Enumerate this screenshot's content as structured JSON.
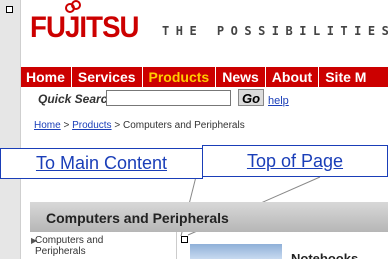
{
  "logo": {
    "text": "FUJITSU"
  },
  "tagline": "THE POSSIBILITIES ARE IN",
  "nav": [
    {
      "label": "Home",
      "active": false
    },
    {
      "label": "Services",
      "active": false
    },
    {
      "label": "Products",
      "active": true
    },
    {
      "label": "News",
      "active": false
    },
    {
      "label": "About",
      "active": false
    },
    {
      "label": "Site M",
      "active": false
    }
  ],
  "search": {
    "label": "Quick Search",
    "value": "",
    "button_label": "Go",
    "help_label": "help"
  },
  "breadcrumb": {
    "home": "Home",
    "sep1": " > ",
    "products": "Products",
    "sep2": " > ",
    "current": "Computers and Peripherals"
  },
  "skip_links": {
    "main": "To Main Content",
    "top": "Top of Page"
  },
  "section": {
    "title": "Computers and Peripherals"
  },
  "side_menu": {
    "item": "Computers and Peripherals"
  },
  "feature": {
    "label": "Notebooks"
  },
  "colors": {
    "brand": "#cc0000",
    "active_nav": "#ffcc00",
    "link": "#1a3eb8"
  }
}
